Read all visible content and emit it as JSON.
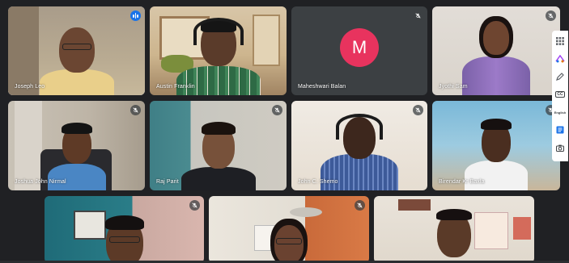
{
  "participants": [
    {
      "name": "Joseph Leo",
      "status": "speaking"
    },
    {
      "name": "Austin Franklin",
      "status": "none"
    },
    {
      "name": "Maheshwari Balan",
      "status": "muted",
      "initial": "M"
    },
    {
      "name": "Jyothi Sam",
      "status": "muted"
    },
    {
      "name": "Joshua John Nirmal",
      "status": "muted"
    },
    {
      "name": "Raj Parit",
      "status": "muted"
    },
    {
      "name": "John C. Shemo",
      "status": "muted"
    },
    {
      "name": "Birendar Kr Baxla",
      "status": "muted"
    },
    {
      "name": "",
      "status": "muted"
    },
    {
      "name": "",
      "status": "muted"
    },
    {
      "name": "",
      "status": "none"
    }
  ],
  "side_panel": {
    "captions_label": "CC",
    "language_label": "English"
  },
  "colors": {
    "background": "#202124",
    "avatar_bg": "#e8335e",
    "speaking_accent": "#1a73e8"
  },
  "icons": [
    "mic-off-icon",
    "speaking-indicator-icon",
    "apps-grid-icon",
    "palette-icon",
    "pen-icon",
    "captions-icon",
    "chat-icon",
    "camera-icon"
  ]
}
